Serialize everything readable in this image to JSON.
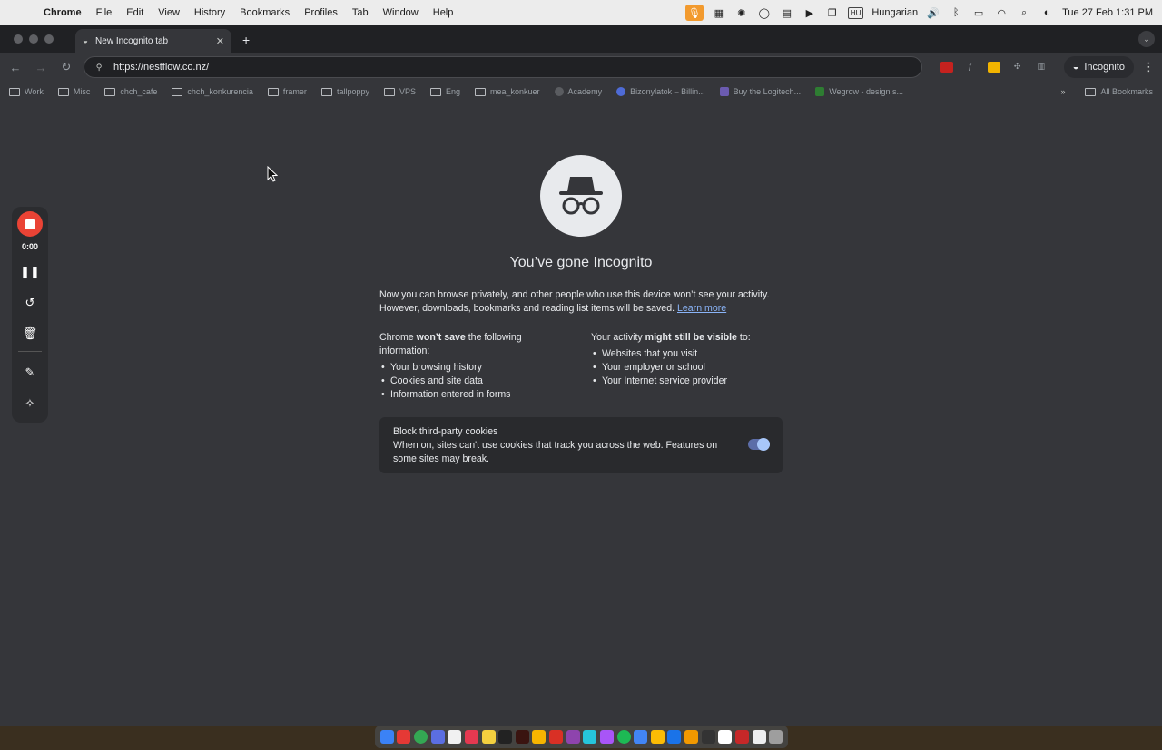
{
  "menubar": {
    "app_name": "Chrome",
    "items": [
      "File",
      "Edit",
      "View",
      "History",
      "Bookmarks",
      "Profiles",
      "Tab",
      "Window",
      "Help"
    ],
    "status": {
      "input_source_code": "HU",
      "input_source": "Hungarian",
      "datetime": "Tue 27 Feb  1:31 PM"
    }
  },
  "tab": {
    "title": "New Incognito tab",
    "close": "✕",
    "new_tab": "+"
  },
  "toolbar": {
    "url": "https://nestflow.co.nz/",
    "profile_label": "Incognito"
  },
  "bookmarks": {
    "items": [
      {
        "label": "Work",
        "kind": "folder"
      },
      {
        "label": "Misc",
        "kind": "folder"
      },
      {
        "label": "chch_cafe",
        "kind": "folder"
      },
      {
        "label": "chch_konkurencia",
        "kind": "folder"
      },
      {
        "label": "framer",
        "kind": "folder"
      },
      {
        "label": "tallpoppy",
        "kind": "folder"
      },
      {
        "label": "VPS",
        "kind": "folder"
      },
      {
        "label": "Eng",
        "kind": "folder"
      },
      {
        "label": "mea_konkuer",
        "kind": "folder"
      },
      {
        "label": "Academy",
        "kind": "site"
      },
      {
        "label": "Bizonylatok – Billin...",
        "kind": "site"
      },
      {
        "label": "Buy the Logitech...",
        "kind": "site"
      },
      {
        "label": "Wegrow - design s...",
        "kind": "site"
      }
    ],
    "overflow": "»",
    "all_bookmarks": "All Bookmarks"
  },
  "content": {
    "headline": "You’ve gone Incognito",
    "intro": "Now you can browse privately, and other people who use this device won’t see your activity. However, downloads, bookmarks and reading list items will be saved.",
    "learn_more": "Learn more",
    "left_col": {
      "prefix": "Chrome ",
      "emph": "won’t save",
      "suffix": " the following information:",
      "items": [
        "Your browsing history",
        "Cookies and site data",
        "Information entered in forms"
      ]
    },
    "right_col": {
      "prefix": "Your activity ",
      "emph": "might still be visible",
      "suffix": " to:",
      "items": [
        "Websites that you visit",
        "Your employer or school",
        "Your Internet service provider"
      ]
    },
    "cookie_card": {
      "title": "Block third-party cookies",
      "desc": "When on, sites can't use cookies that track you across the web. Features on some sites may break.",
      "enabled": true
    }
  },
  "recorder": {
    "time": "0:00"
  },
  "colors": {
    "accent": "#8ab4f8",
    "record": "#ea4335",
    "page_bg": "#35363a"
  }
}
